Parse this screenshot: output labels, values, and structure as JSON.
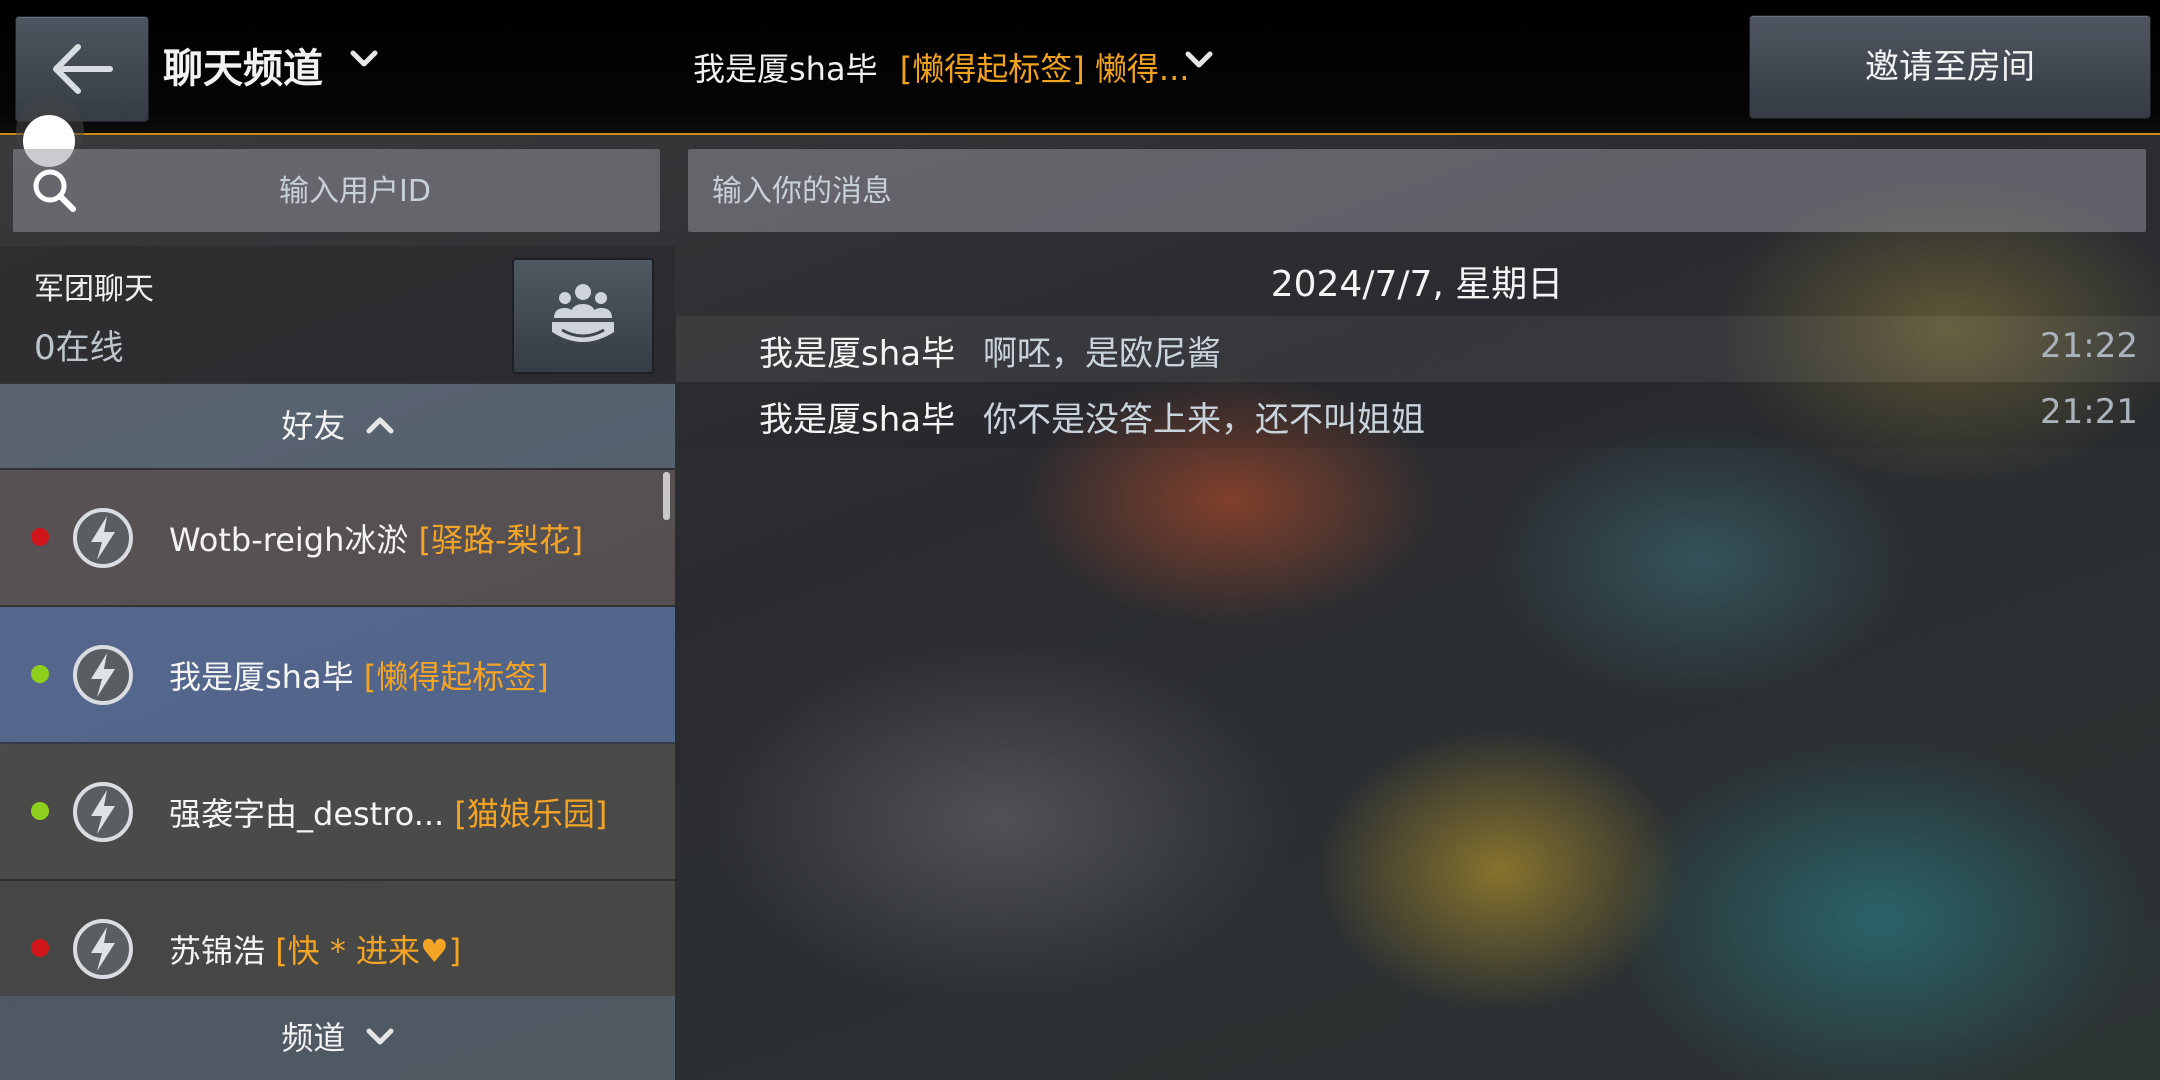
{
  "header": {
    "back_icon": "arrow-left-icon",
    "channel_title": "聊天频道",
    "room_name": "我是厦sha毕",
    "room_tag": "[懒得起标签] 懒得...",
    "invite_label": "邀请至房间"
  },
  "search": {
    "user_placeholder": "输入用户ID",
    "message_placeholder": "输入你的消息"
  },
  "legion": {
    "title": "军团聊天",
    "online": "0在线",
    "button_icon": "group-icon"
  },
  "sections": {
    "friends_label": "好友",
    "channel_label": "频道"
  },
  "friends": [
    {
      "name": "Wotb-reigh冰淤",
      "tag": "[驿路-梨花]",
      "status": "offline",
      "status_color": "#d0161b",
      "icon": "lightning-rank-icon"
    },
    {
      "name": "我是厦sha毕",
      "tag": "[懒得起标签]",
      "status": "online",
      "status_color": "#8fcf1e",
      "icon": "lightning-rank-icon"
    },
    {
      "name": "强袭字由_destro...",
      "tag": "[猫娘乐园]",
      "status": "online",
      "status_color": "#8fcf1e",
      "icon": "lightning-rank-icon"
    },
    {
      "name": "苏锦浩",
      "tag": "[快 * 进来♥]",
      "status": "offline",
      "status_color": "#d0161b",
      "icon": "lightning-rank-icon"
    }
  ],
  "chat": {
    "date": "2024/7/7, 星期日",
    "messages": [
      {
        "sender": "我是厦sha毕",
        "text": "啊呸，是欧尼酱",
        "time": "21:22"
      },
      {
        "sender": "我是厦sha毕",
        "text": "你不是没答上来，还不叫姐姐",
        "time": "21:21"
      }
    ]
  },
  "colors": {
    "accent_orange": "#f0a21e",
    "online": "#8fcf1e",
    "offline": "#d0161b"
  }
}
